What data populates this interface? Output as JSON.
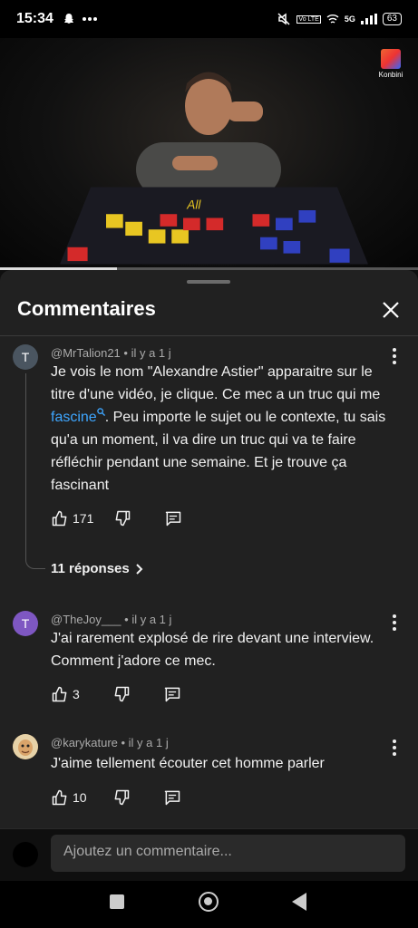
{
  "status_bar": {
    "time": "15:34",
    "network": "5G",
    "volte": "Vo LTE",
    "battery": "63"
  },
  "video": {
    "channel_logo": "Konbini",
    "progress": 0.28
  },
  "comments_panel": {
    "title": "Commentaires",
    "comments": [
      {
        "avatar_letter": "T",
        "avatar_color": "#4a5560",
        "author": "@MrTalion21",
        "time": "il y a 1 j",
        "text_before_link": "Je vois le nom \"Alexandre Astier\" apparaitre sur le titre d'une vidéo, je clique. Ce mec a un truc qui me ",
        "link": "fascine",
        "text_after_link": ". Peu importe le sujet ou le contexte, tu sais qu'a un moment, il va dire un truc qui va te faire réfléchir pendant une semaine. Et je trouve ça fascinant",
        "likes": "171",
        "replies": "11 réponses"
      },
      {
        "avatar_letter": "T",
        "avatar_color": "#7e57c2",
        "author": "@TheJoy___",
        "time": "il y a 1 j",
        "text": "J'ai rarement explosé de rire devant une interview. Comment j'adore ce mec.",
        "likes": "3"
      },
      {
        "avatar_letter": "",
        "avatar_color": "#c9a66b",
        "author": "@karykature",
        "time": "il y a 1 j",
        "text": "J'aime tellement écouter cet homme parler",
        "likes": "10"
      }
    ]
  },
  "input": {
    "placeholder": "Ajoutez un commentaire..."
  }
}
